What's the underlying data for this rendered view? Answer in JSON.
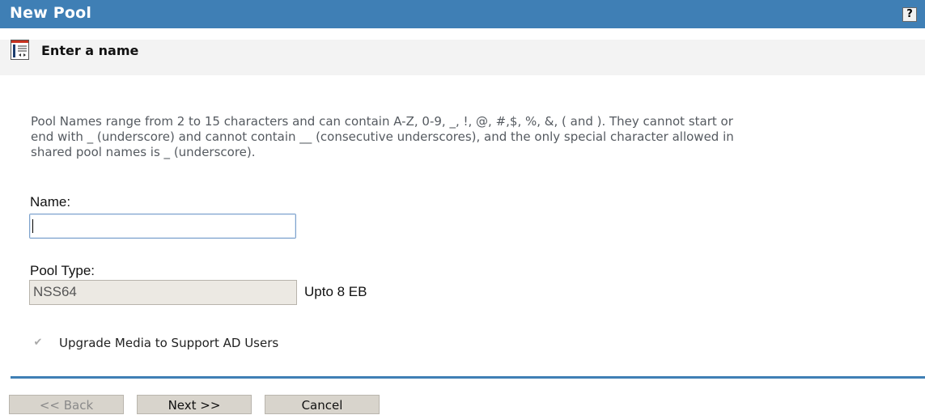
{
  "header": {
    "title": "New Pool",
    "help_label": "?"
  },
  "step": {
    "icon": "wizard-step-icon",
    "title": "Enter a name"
  },
  "description": "Pool Names range from 2 to 15 characters and can contain A-Z, 0-9, _, !, @, #,$, %, &, ( and ). They cannot start or\nend with _ (underscore) and cannot contain __ (consecutive underscores), and the only special character allowed in\nshared pool names is _ (underscore).",
  "form": {
    "name_label": "Name:",
    "name_value": "",
    "pool_type_label": "Pool Type:",
    "pool_type_value": "NSS64",
    "pool_type_size": "Upto 8 EB",
    "upgrade_checkbox_label": "Upgrade Media to Support AD Users",
    "upgrade_checked": true
  },
  "buttons": {
    "back": "<< Back",
    "next": "Next >>",
    "cancel": "Cancel"
  },
  "colors": {
    "header_bg": "#3f7fb5",
    "subheader_bg": "#f3f3f3",
    "description_text": "#555a60",
    "button_bg": "#d8d4cc"
  }
}
